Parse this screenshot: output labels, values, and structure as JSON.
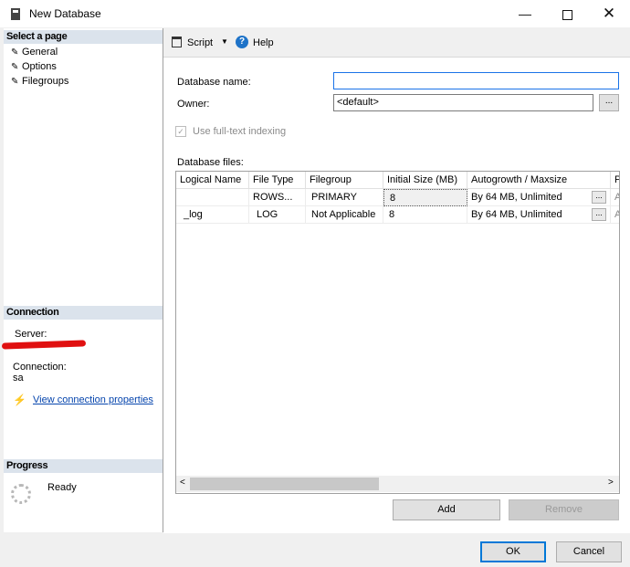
{
  "window": {
    "title": "New Database",
    "min_glyph": "—",
    "close_glyph": "✕"
  },
  "sidebar": {
    "select_page_header": "Select a page",
    "pages": [
      "General",
      "Options",
      "Filegroups"
    ],
    "connection_header": "Connection",
    "server_label": "Server:",
    "connection_label": "Connection:",
    "connection_value": "sa",
    "view_connection_link": "View connection properties",
    "progress_header": "Progress",
    "progress_status": "Ready"
  },
  "toolbar": {
    "script_label": "Script",
    "help_label": "Help"
  },
  "form": {
    "database_name_label": "Database name:",
    "database_name_value": "",
    "owner_label": "Owner:",
    "owner_value": "<default>",
    "browse_label": "...",
    "fulltext_label": "Use full-text indexing",
    "fulltext_checked": true,
    "files_label": "Database files:"
  },
  "grid": {
    "columns": [
      "Logical Name",
      "File Type",
      "Filegroup",
      "Initial Size (MB)",
      "Autogrowth / Maxsize",
      "P"
    ],
    "rows": [
      {
        "logical_name": "",
        "file_type": "ROWS...",
        "filegroup": "PRIMARY",
        "initial_size": "8",
        "autogrowth": "By 64 MB, Unlimited",
        "path": "A"
      },
      {
        "logical_name": "_log",
        "file_type": "LOG",
        "filegroup": "Not Applicable",
        "initial_size": "8",
        "autogrowth": "By 64 MB, Unlimited",
        "path": "A"
      }
    ],
    "cell_button_label": "..."
  },
  "buttons": {
    "add": "Add",
    "remove": "Remove",
    "ok": "OK",
    "cancel": "Cancel"
  }
}
